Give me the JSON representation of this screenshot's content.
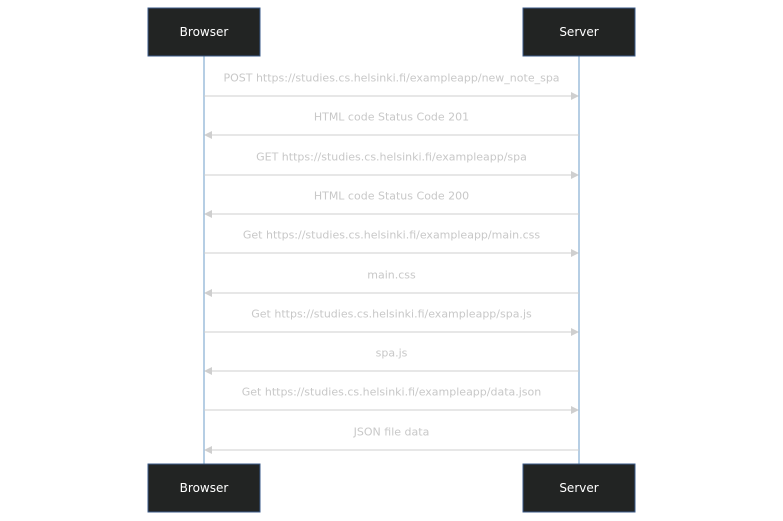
{
  "participants": {
    "browser": "Browser",
    "server": "Server"
  },
  "messages": [
    {
      "from": "browser",
      "to": "server",
      "label": "POST https://studies.cs.helsinki.fi/exampleapp/new_note_spa"
    },
    {
      "from": "server",
      "to": "browser",
      "label": "HTML code Status Code 201"
    },
    {
      "from": "browser",
      "to": "server",
      "label": "GET https://studies.cs.helsinki.fi/exampleapp/spa"
    },
    {
      "from": "server",
      "to": "browser",
      "label": "HTML code Status Code 200"
    },
    {
      "from": "browser",
      "to": "server",
      "label": "Get https://studies.cs.helsinki.fi/exampleapp/main.css"
    },
    {
      "from": "server",
      "to": "browser",
      "label": "main.css"
    },
    {
      "from": "browser",
      "to": "server",
      "label": "Get https://studies.cs.helsinki.fi/exampleapp/spa.js"
    },
    {
      "from": "server",
      "to": "browser",
      "label": "spa.js"
    },
    {
      "from": "browser",
      "to": "server",
      "label": "Get https://studies.cs.helsinki.fi/exampleapp/data.json"
    },
    {
      "from": "server",
      "to": "browser",
      "label": "JSON file data"
    }
  ],
  "colors": {
    "actor_fill": "#222423",
    "lifeline": "#6d9cc8",
    "message": "#cfcfcf",
    "label": "#c8c8c8"
  }
}
